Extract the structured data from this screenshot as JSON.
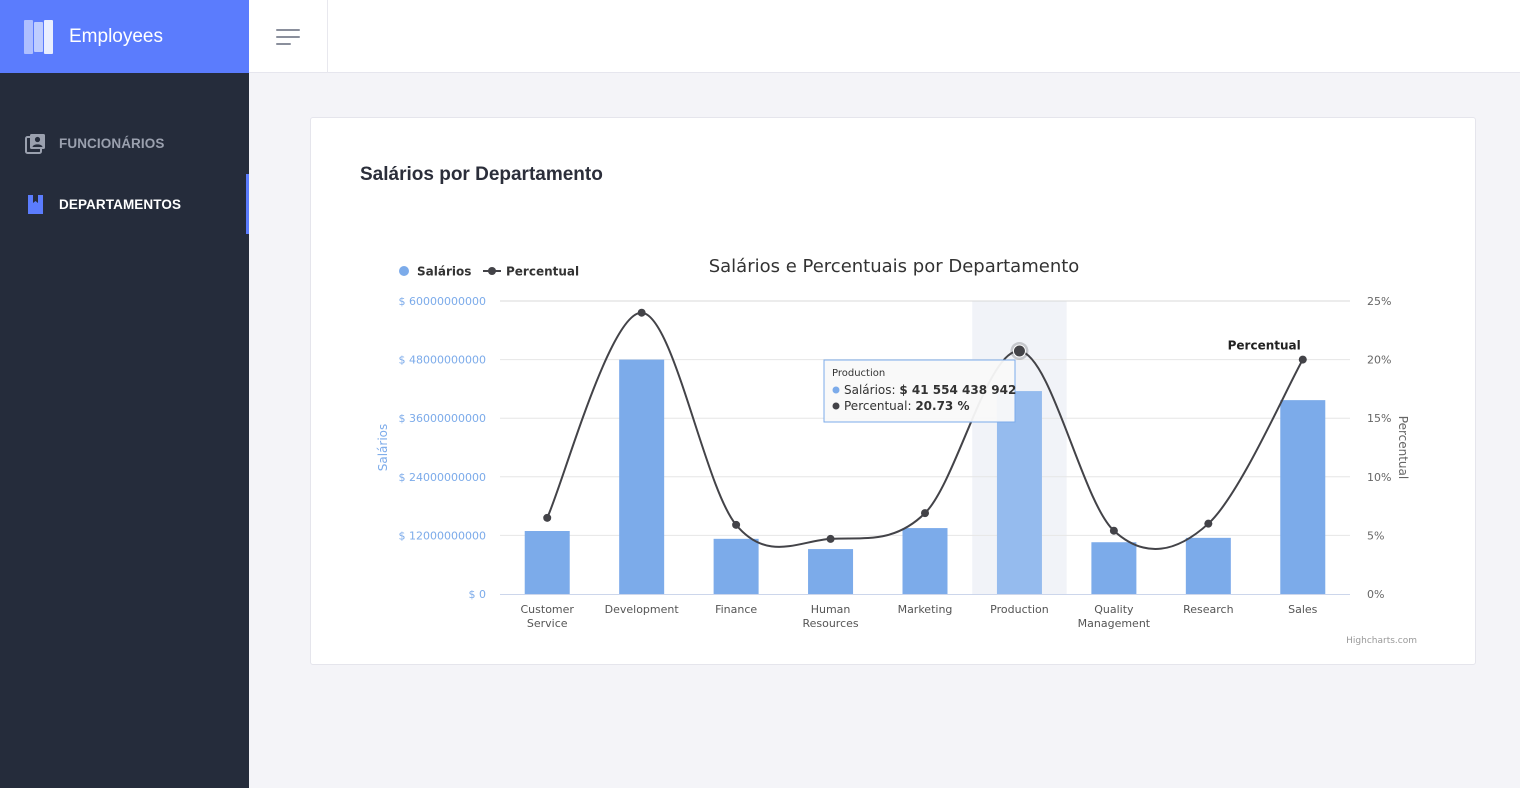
{
  "app": {
    "brand": "Employees"
  },
  "sidebar": {
    "items": [
      {
        "label": "FUNCIONÁRIOS",
        "icon": "contacts-icon",
        "active": false
      },
      {
        "label": "DEPARTAMENTOS",
        "icon": "bookmark-icon",
        "active": true
      }
    ]
  },
  "colors": {
    "brand": "#5b7cfd",
    "sidebar": "#252c3b",
    "bar": "#7cabea",
    "line": "#434348"
  },
  "page": {
    "title": "Salários por Departamento"
  },
  "chart_data": {
    "type": "bar",
    "title": "Salários e Percentuais por Departamento",
    "categories": [
      "Customer Service",
      "Development",
      "Finance",
      "Human Resources",
      "Marketing",
      "Production",
      "Quality Management",
      "Research",
      "Sales"
    ],
    "series": [
      {
        "name": "Salários",
        "type": "bar",
        "axis": "left",
        "values": [
          12900000000,
          48000000000,
          11300000000,
          9200000000,
          13500000000,
          41554438942,
          10600000000,
          11500000000,
          39700000000
        ]
      },
      {
        "name": "Percentual",
        "type": "spline",
        "axis": "right",
        "values": [
          6.5,
          24.0,
          5.9,
          4.7,
          6.9,
          20.73,
          5.4,
          6.0,
          20.0
        ]
      }
    ],
    "yleft": {
      "label": "Salários",
      "ticks": [
        "$ 0",
        "$ 12000000000",
        "$ 24000000000",
        "$ 36000000000",
        "$ 48000000000",
        "$ 60000000000"
      ],
      "ylim": [
        0,
        60000000000
      ]
    },
    "yright": {
      "label": "Percentual",
      "ticks": [
        "0%",
        "5%",
        "10%",
        "15%",
        "20%",
        "25%"
      ],
      "ylim": [
        0,
        25
      ]
    },
    "legend": {
      "placement": "top-left",
      "items": [
        "Salários",
        "Percentual"
      ]
    },
    "grid": true,
    "highlighted_category": "Production",
    "tooltip": {
      "header": "Production",
      "rows": [
        {
          "label": "Salários:",
          "value": "$ 41 554 438 942"
        },
        {
          "label": "Percentual:",
          "value": "20.73 %"
        }
      ]
    },
    "series_label": "Percentual",
    "credits": "Highcharts.com"
  }
}
